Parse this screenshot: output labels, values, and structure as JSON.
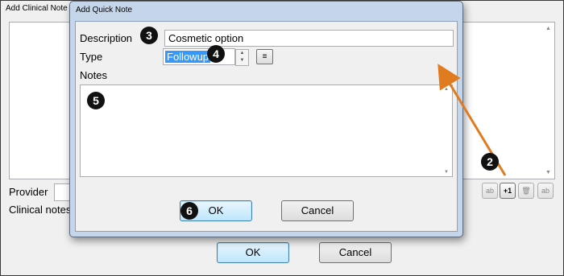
{
  "background_window": {
    "title": "Add Clinical Note",
    "provider_label": "Provider",
    "clinical_notes_label": "Clinical notes",
    "toolbar": [
      {
        "name": "edit-tool-button",
        "label": "ab"
      },
      {
        "name": "increment-button",
        "label": "+1"
      },
      {
        "name": "delete-tool-button",
        "label": "🗑"
      },
      {
        "name": "replace-tool-button",
        "label": "ab"
      }
    ],
    "ok_label": "OK",
    "cancel_label": "Cancel"
  },
  "dialog": {
    "title": "Add Quick Note",
    "description_label": "Description",
    "description_value": "Cosmetic option",
    "type_label": "Type",
    "type_value": "Followup",
    "notes_label": "Notes",
    "notes_value": "",
    "ok_label": "OK",
    "cancel_label": "Cancel"
  },
  "annotations": {
    "badge_2": "2",
    "badge_3": "3",
    "badge_4": "4",
    "badge_5": "5",
    "badge_6": "6",
    "arrow_color": "#e07b20"
  }
}
